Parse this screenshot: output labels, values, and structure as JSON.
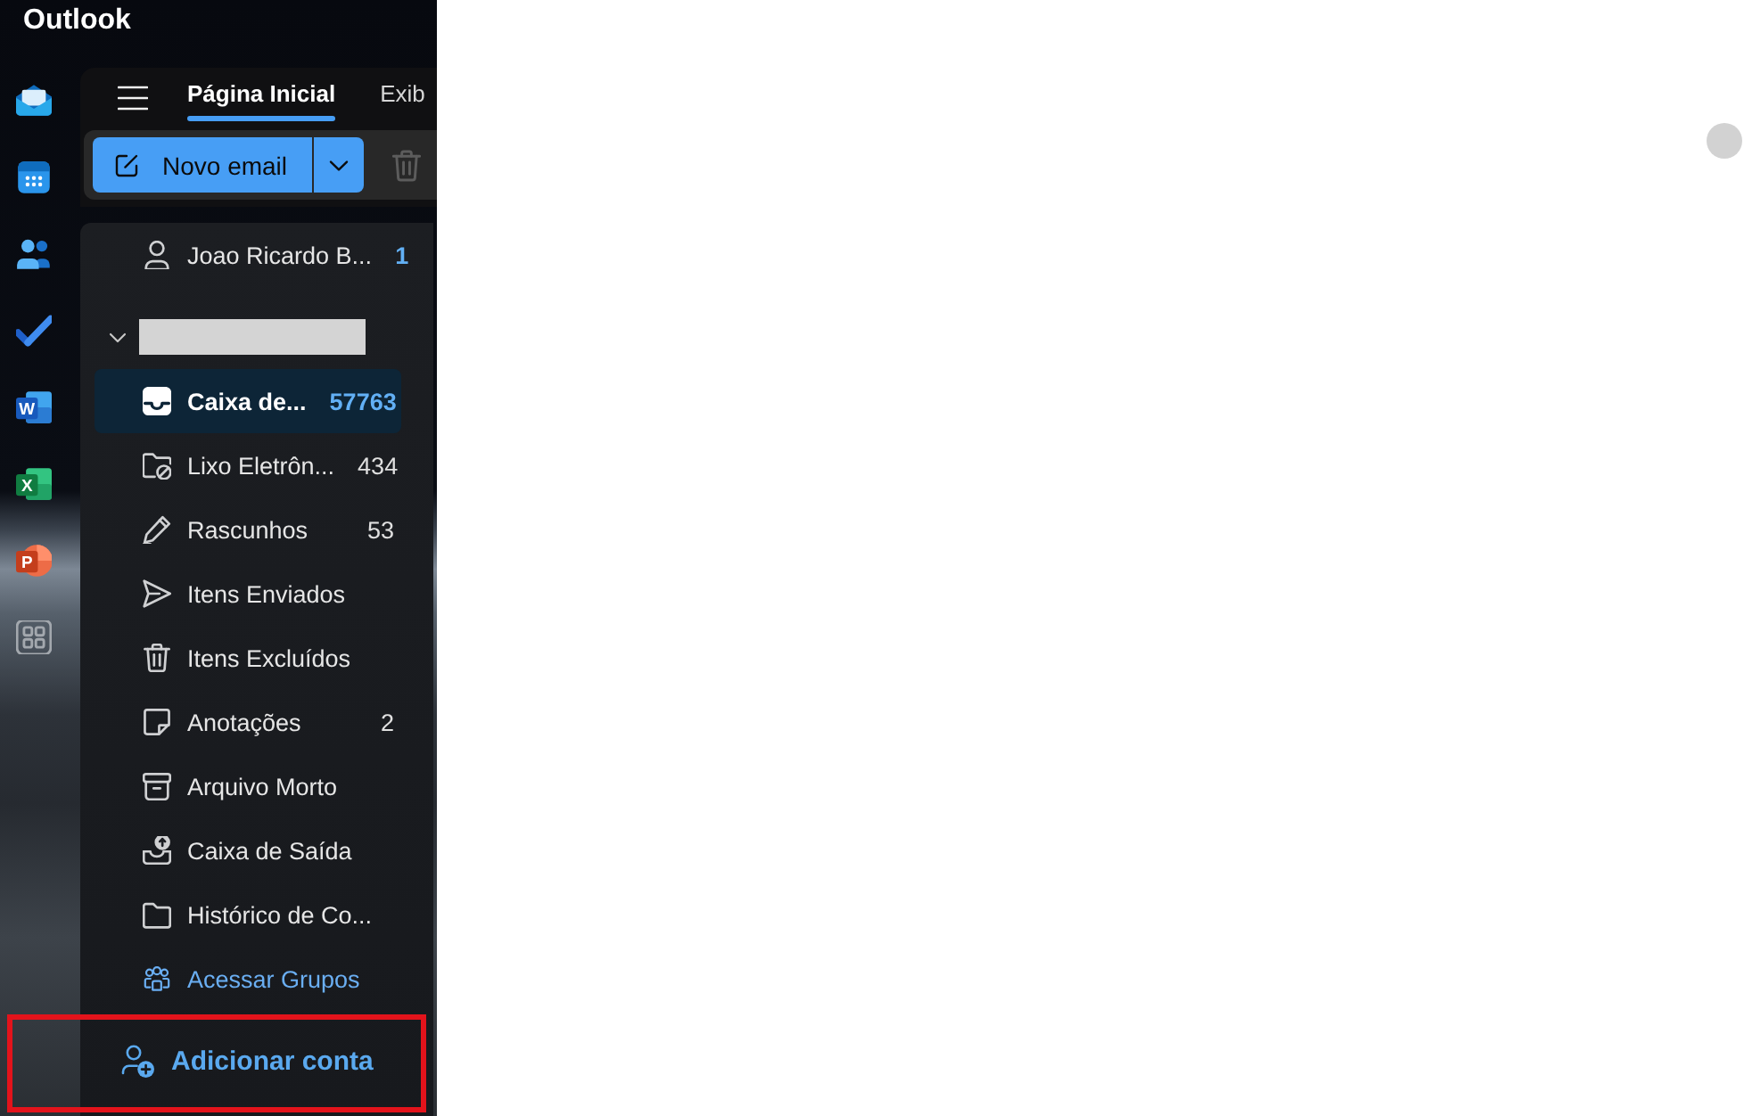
{
  "window": {
    "title": "Outlook"
  },
  "app_rail": [
    {
      "kind": "mail"
    },
    {
      "kind": "calendar"
    },
    {
      "kind": "people"
    },
    {
      "kind": "todo"
    },
    {
      "kind": "word",
      "letter": "W"
    },
    {
      "kind": "excel",
      "letter": "X"
    },
    {
      "kind": "powerpoint",
      "letter": "P"
    },
    {
      "kind": "apps"
    }
  ],
  "ribbon": {
    "tabs": [
      {
        "label": "Página Inicial",
        "selected": true
      },
      {
        "label": "Exib",
        "selected": false
      }
    ],
    "toolbar": {
      "new_email": {
        "label": "Novo email"
      },
      "delete": {
        "disabled": true
      }
    }
  },
  "folder_pane": {
    "favorites": [
      {
        "kind": "person",
        "label": "Joao Ricardo B...",
        "count": "1",
        "count_highlighted": true,
        "selected": false
      }
    ],
    "account": {
      "expanded": true,
      "folders": [
        {
          "kind": "inbox",
          "label": "Caixa de...",
          "count": "57763",
          "count_highlighted": true,
          "selected": true
        },
        {
          "kind": "junk",
          "label": "Lixo Eletrôn...",
          "count": "434",
          "count_highlighted": false,
          "selected": false
        },
        {
          "kind": "drafts",
          "label": "Rascunhos",
          "count": "53",
          "count_highlighted": false,
          "selected": false
        },
        {
          "kind": "sent",
          "label": "Itens Enviados",
          "selected": false
        },
        {
          "kind": "deleted",
          "label": "Itens Excluídos",
          "selected": false
        },
        {
          "kind": "notes",
          "label": "Anotações",
          "count": "2",
          "count_highlighted": false,
          "selected": false
        },
        {
          "kind": "archive",
          "label": "Arquivo Morto",
          "selected": false
        },
        {
          "kind": "outbox",
          "label": "Caixa de Saída",
          "selected": false
        },
        {
          "kind": "folder",
          "label": "Histórico de Co...",
          "selected": false
        }
      ]
    },
    "groups_link": {
      "label": "Acessar Grupos"
    },
    "add_account": {
      "label": "Adicionar conta",
      "highlighted": true
    }
  }
}
